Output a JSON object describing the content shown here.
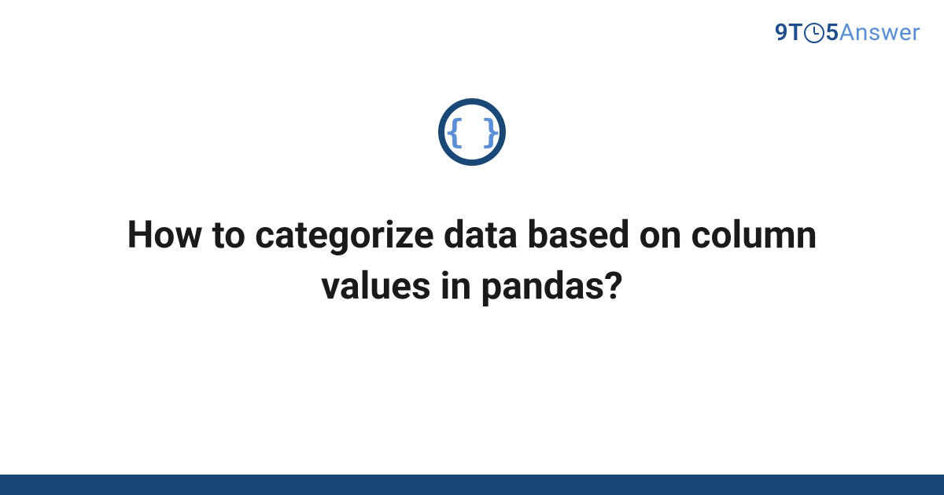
{
  "logo": {
    "prefix": "9T",
    "suffix": "5",
    "answer": "Answer"
  },
  "icon": {
    "name": "code-braces-icon",
    "glyph": "{ }"
  },
  "title": "How to categorize data based on column values in pandas?",
  "colors": {
    "brand_dark": "#1a4876",
    "brand_light": "#5a8fd6",
    "text": "#1a1a1a"
  }
}
